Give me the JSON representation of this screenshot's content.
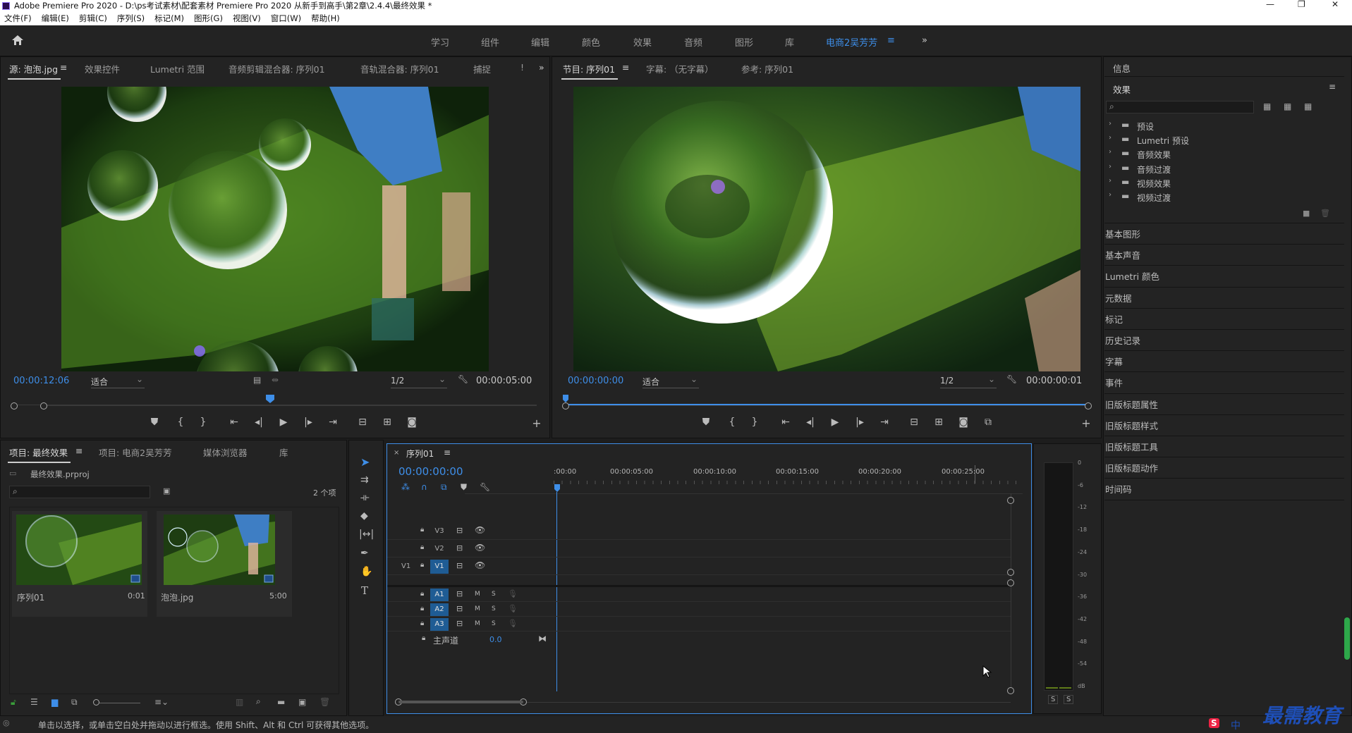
{
  "window": {
    "title": "Adobe Premiere Pro 2020 - D:\\ps考试素材\\配套素材 Premiere Pro 2020 从新手到高手\\第2章\\2.4.4\\最终效果 *"
  },
  "menu": [
    "文件(F)",
    "编辑(E)",
    "剪辑(C)",
    "序列(S)",
    "标记(M)",
    "图形(G)",
    "视图(V)",
    "窗口(W)",
    "帮助(H)"
  ],
  "workspace_tabs": [
    "学习",
    "组件",
    "编辑",
    "颜色",
    "效果",
    "音频",
    "图形",
    "库",
    "电商2吴芳芳"
  ],
  "source_panel": {
    "tabs": [
      "源: 泡泡.jpg",
      "效果控件",
      "Lumetri 范围",
      "音频剪辑混合器: 序列01",
      "音轨混合器: 序列01",
      "捕捉"
    ],
    "timecode_in": "00:00:12:06",
    "fit": "适合",
    "quality": "1/2",
    "duration": "00:00:05:00"
  },
  "program_panel": {
    "tabs": [
      "节目: 序列01",
      "字幕: （无字幕）",
      "参考: 序列01"
    ],
    "timecode_in": "00:00:00:00",
    "fit": "适合",
    "quality": "1/2",
    "duration": "00:00:00:01"
  },
  "project_panel": {
    "tabs": [
      "项目: 最终效果",
      "项目: 电商2吴芳芳",
      "媒体浏览器",
      "库"
    ],
    "file": "最终效果.prproj",
    "count": "2 个项",
    "items": [
      {
        "name": "序列01",
        "duration": "0:01"
      },
      {
        "name": "泡泡.jpg",
        "duration": "5:00"
      }
    ]
  },
  "timeline": {
    "tab": "序列01",
    "timecode": "00:00:00:00",
    "ruler": [
      ":00:00",
      "00:00:05:00",
      "00:00:10:00",
      "00:00:15:00",
      "00:00:20:00",
      "00:00:25:00"
    ],
    "video_tracks": [
      "V3",
      "V2",
      "V1"
    ],
    "source_patch": "V1",
    "audio_tracks": [
      "A1",
      "A2",
      "A3"
    ],
    "master": {
      "label": "主声道",
      "value": "0.0"
    },
    "track_buttons": {
      "mute": "M",
      "solo": "S"
    }
  },
  "meter": {
    "scale": [
      "0",
      "-6",
      "-12",
      "-18",
      "-24",
      "-30",
      "-36",
      "-42",
      "-48",
      "-54",
      "dB"
    ],
    "buttons": [
      "S",
      "S"
    ]
  },
  "right_panel": {
    "info": "信息",
    "effects_title": "效果",
    "effects_tree": [
      "预设",
      "Lumetri 预设",
      "音频效果",
      "音频过渡",
      "视频效果",
      "视频过渡"
    ],
    "sections": [
      "基本图形",
      "基本声音",
      "Lumetri 颜色",
      "元数据",
      "标记",
      "历史记录",
      "字幕",
      "事件",
      "旧版标题属性",
      "旧版标题样式",
      "旧版标题工具",
      "旧版标题动作",
      "时间码"
    ]
  },
  "status_bar": "单击以选择，或单击空白处并拖动以进行框选。使用 Shift、Alt 和 Ctrl 可获得其他选项。",
  "watermark": "最需教育",
  "ime": "中"
}
